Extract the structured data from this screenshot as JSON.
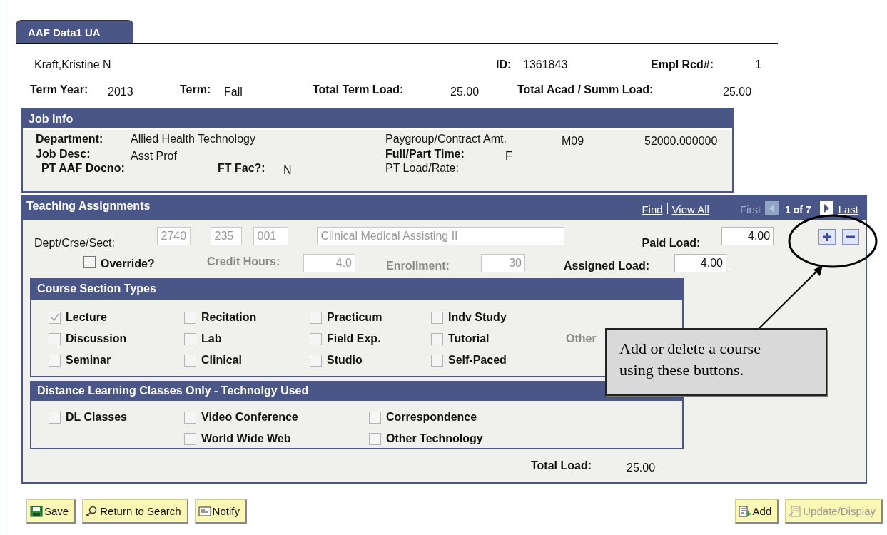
{
  "tab": {
    "label": "AAF Data1 UA",
    "selected": true
  },
  "employee": {
    "name": "Kraft,Kristine N",
    "id_label": "ID:",
    "id": "1361843",
    "empl_rcd_label": "Empl Rcd#:",
    "empl_rcd": "1"
  },
  "term": [
    {
      "label": "Term Year:",
      "value": "2013"
    },
    {
      "label": "Term:",
      "value": "Fall"
    },
    {
      "label": "Total Term Load:",
      "value": "25.00"
    },
    {
      "label": "Total Acad / Summ Load:",
      "value": "25.00"
    }
  ],
  "job_info": {
    "title": "Job Info",
    "department": {
      "label": "Department:",
      "value": "Allied Health Technology"
    },
    "job_desc": {
      "label": "Job Desc:",
      "value": "Asst Prof"
    },
    "paygroup": {
      "label": "Paygroup/Contract Amt.",
      "code": "M09",
      "amount": "52000.000000"
    },
    "full_part_time": {
      "label": "Full/Part Time:",
      "value": "F"
    },
    "pt_aaf_docno": {
      "label": "PT AAF Docno:"
    },
    "ft_fac": {
      "label": "FT Fac?:",
      "value": "N"
    },
    "pt_load_rate": {
      "label": "PT Load/Rate:"
    }
  },
  "teaching": {
    "title": "Teaching Assignments",
    "find": "Find",
    "view_all": "View All",
    "first": {
      "label": "First",
      "disabled": true
    },
    "counter": "1 of 7",
    "last": {
      "label": "Last",
      "disabled": false
    },
    "dept_crse_sect": {
      "label": "Dept/Crse/Sect:",
      "dept": "2740",
      "course": "235",
      "section": "001",
      "description": "Clinical Medical Assisting II",
      "disabled": true
    },
    "paid_load": {
      "label": "Paid Load:",
      "value": "4.00",
      "disabled": false
    },
    "override": {
      "label": "Override?",
      "checked": false
    },
    "credit_hours": {
      "label": "Credit Hours:",
      "value": "4.0",
      "disabled": true
    },
    "enrollment": {
      "label": "Enrollment:",
      "value": "30",
      "disabled": true
    },
    "assigned_load": {
      "label": "Assigned Load:",
      "value": "4.00",
      "disabled": false
    },
    "section_types": {
      "title": "Course Section Types",
      "other_label": "Other",
      "columns": [
        [
          {
            "label": "Lecture",
            "checked": true
          },
          {
            "label": "Discussion",
            "checked": false
          },
          {
            "label": "Seminar",
            "checked": false
          }
        ],
        [
          {
            "label": "Recitation",
            "checked": false
          },
          {
            "label": "Lab",
            "checked": false
          },
          {
            "label": "Clinical",
            "checked": false
          }
        ],
        [
          {
            "label": "Practicum",
            "checked": false
          },
          {
            "label": "Field Exp.",
            "checked": false
          },
          {
            "label": "Studio",
            "checked": false
          }
        ],
        [
          {
            "label": "Indv Study",
            "checked": false
          },
          {
            "label": "Tutorial",
            "checked": false
          },
          {
            "label": "Self-Paced",
            "checked": false
          }
        ]
      ]
    },
    "distance_learning": {
      "title": "Distance Learning Classes Only - Technolgy Used",
      "columns": [
        [
          {
            "label": "DL Classes",
            "checked": false
          }
        ],
        [
          {
            "label": "Video Conference",
            "checked": false
          },
          {
            "label": "World Wide Web",
            "checked": false
          }
        ],
        [
          {
            "label": "Correspondence",
            "checked": false
          },
          {
            "label": "Other Technology",
            "checked": false
          }
        ]
      ]
    },
    "total_load": {
      "label": "Total Load:",
      "value": "25.00"
    }
  },
  "buttons_left": [
    {
      "label": "Save",
      "kind": "save",
      "disabled": false
    },
    {
      "label": "Return to Search",
      "kind": "search",
      "disabled": false
    },
    {
      "label": "Notify",
      "kind": "notify",
      "disabled": false
    }
  ],
  "buttons_right": [
    {
      "label": "Add",
      "kind": "add",
      "disabled": false
    },
    {
      "label": "Update/Display",
      "kind": "update",
      "disabled": true
    }
  ],
  "callout": {
    "text": "Add or delete a course using these buttons."
  }
}
